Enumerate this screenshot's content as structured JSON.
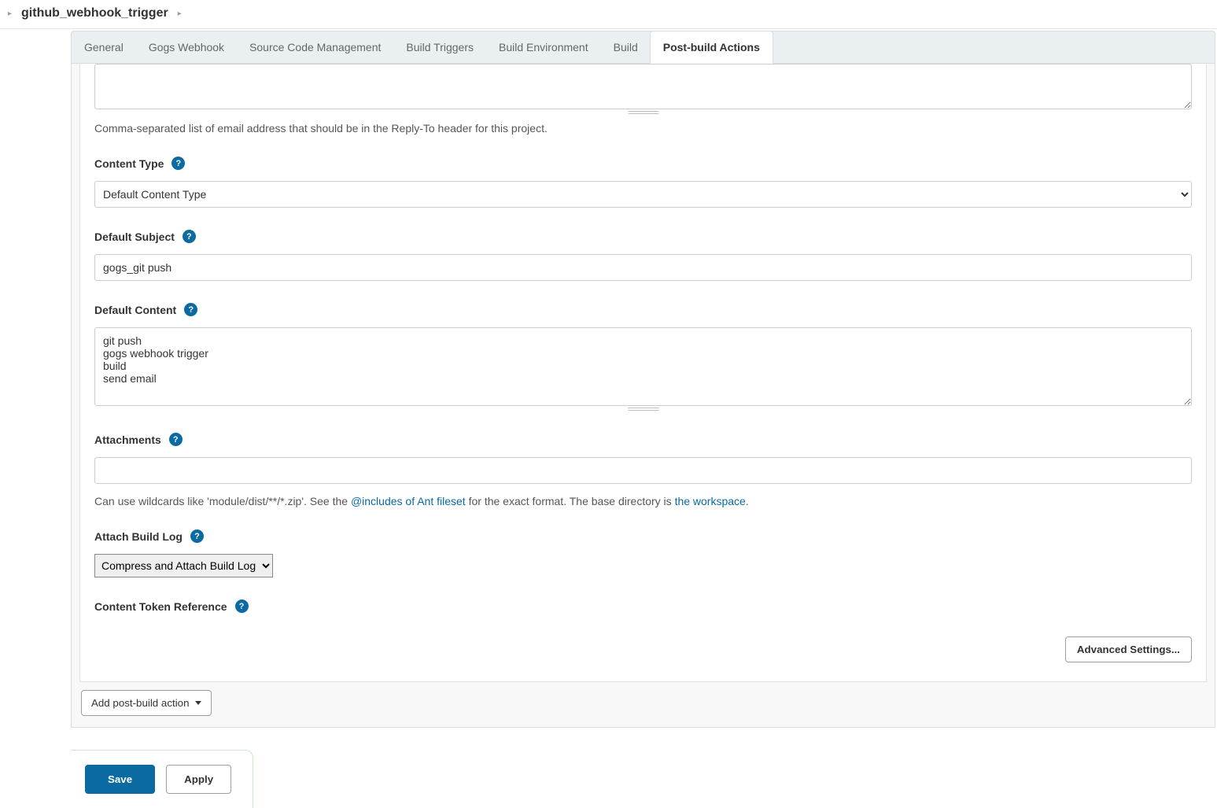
{
  "breadcrumb": {
    "name": "github_webhook_trigger"
  },
  "tabs": [
    {
      "label": "General"
    },
    {
      "label": "Gogs Webhook"
    },
    {
      "label": "Source Code Management"
    },
    {
      "label": "Build Triggers"
    },
    {
      "label": "Build Environment"
    },
    {
      "label": "Build"
    },
    {
      "label": "Post-build Actions"
    }
  ],
  "fields": {
    "reply_to_value": "",
    "reply_to_help": "Comma-separated list of email address that should be in the Reply-To header for this project.",
    "content_type_label": "Content Type",
    "content_type_value": "Default Content Type",
    "default_subject_label": "Default Subject",
    "default_subject_value": "gogs_git push",
    "default_content_label": "Default Content",
    "default_content_value": "git push\ngogs webhook trigger\nbuild\nsend email",
    "attachments_label": "Attachments",
    "attachments_value": "",
    "attachments_help_pre": "Can use wildcards like 'module/dist/**/*.zip'. See the ",
    "attachments_help_link1": "@includes of Ant fileset",
    "attachments_help_mid": " for the exact format. The base directory is ",
    "attachments_help_link2": "the workspace",
    "attachments_help_post": ".",
    "attach_build_log_label": "Attach Build Log",
    "attach_build_log_value": "Compress and Attach Build Log",
    "token_ref_label": "Content Token Reference"
  },
  "buttons": {
    "advanced": "Advanced Settings...",
    "add_action": "Add post-build action",
    "save": "Save",
    "apply": "Apply"
  }
}
